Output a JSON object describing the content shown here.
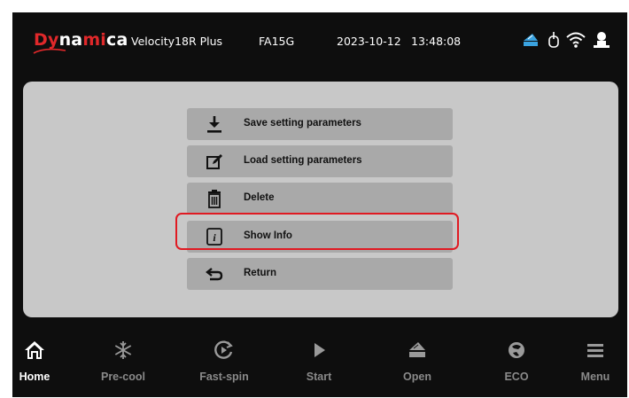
{
  "header": {
    "logo_part1": "Dy",
    "logo_part2": "na",
    "logo_part3": "mi",
    "logo_part4": "ca",
    "model": "Velocity18R Plus",
    "serial": "FA15G",
    "date": "2023-10-12",
    "time": "13:48:08",
    "status_icons": [
      "lid-icon",
      "usb-icon",
      "wifi-icon",
      "user-icon"
    ]
  },
  "menu": {
    "items": [
      {
        "label": "Save setting parameters",
        "icon": "download-icon"
      },
      {
        "label": "Load setting parameters",
        "icon": "edit-icon"
      },
      {
        "label": "Delete",
        "icon": "trash-icon"
      },
      {
        "label": "Show Info",
        "icon": "info-icon",
        "highlighted": true
      },
      {
        "label": "Return",
        "icon": "return-icon"
      }
    ]
  },
  "nav": {
    "items": [
      {
        "label": "Home",
        "icon": "home-icon",
        "active": true
      },
      {
        "label": "Pre-cool",
        "icon": "snowflake-icon"
      },
      {
        "label": "Fast-spin",
        "icon": "fast-spin-icon"
      },
      {
        "label": "Start",
        "icon": "play-icon"
      },
      {
        "label": "Open",
        "icon": "open-lid-icon"
      },
      {
        "label": "ECO",
        "icon": "eco-icon"
      },
      {
        "label": "Menu",
        "icon": "menu-icon"
      }
    ]
  },
  "colors": {
    "background": "#0e0e0e",
    "panel": "#c8c8c8",
    "button": "#a9a9a9",
    "highlight": "#e01a22",
    "brand_red": "#e0282a",
    "lid_blue": "#3aa3e0"
  }
}
